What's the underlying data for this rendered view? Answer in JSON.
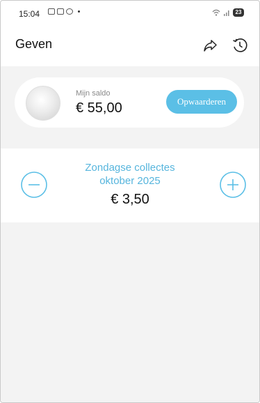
{
  "status_bar": {
    "time": "15:04",
    "battery": "23"
  },
  "header": {
    "title": "Geven",
    "icons": [
      "share-icon",
      "history-icon"
    ]
  },
  "balance": {
    "label": "Mijn saldo",
    "amount": "€ 55,00",
    "topup_label": "Opwaarderen"
  },
  "collection": {
    "title_line1": "Zondagse collectes",
    "title_line2": "oktober 2025",
    "amount": "€ 3,50",
    "icons": [
      "minus-icon",
      "plus-icon"
    ]
  },
  "colors": {
    "accent": "#5bbfe6",
    "accent_text": "#56b5dd",
    "background": "#f3f3f3"
  }
}
